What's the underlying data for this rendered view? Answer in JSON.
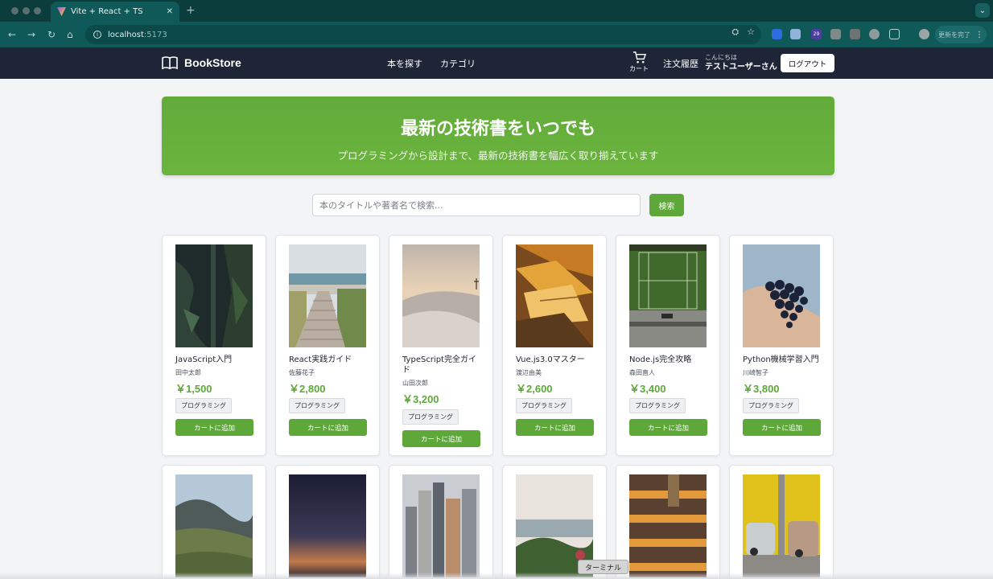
{
  "browser": {
    "tab_title": "Vite + React + TS",
    "new_tab": "+",
    "url_host": "localhost",
    "url_port": ":5173",
    "update_label": "更新を完了",
    "ext_badge": "29"
  },
  "header": {
    "brand": "BookStore",
    "nav": [
      "本を探す",
      "カテゴリ"
    ],
    "cart_label": "カート",
    "orders_label": "注文履歴",
    "greeting": "こんにちは",
    "user_name": "テストユーザーさん",
    "logout_label": "ログアウト"
  },
  "hero": {
    "title": "最新の技術書をいつでも",
    "subtitle": "プログラミングから設計まで、最新の技術書を幅広く取り揃えています"
  },
  "search": {
    "placeholder": "本のタイトルや著者名で検索...",
    "button_label": "検索"
  },
  "books": [
    {
      "title": "JavaScript入門",
      "author": "田中太郎",
      "price": "￥1,500",
      "tag": "プログラミング",
      "add_label": "カートに追加",
      "cover": "moss"
    },
    {
      "title": "React実践ガイド",
      "author": "佐藤花子",
      "price": "￥2,800",
      "tag": "プログラミング",
      "add_label": "カートに追加",
      "cover": "boardwalk"
    },
    {
      "title": "TypeScript完全ガイド",
      "author": "山田次郎",
      "price": "￥3,200",
      "tag": "プログラミング",
      "add_label": "カートに追加",
      "cover": "dune"
    },
    {
      "title": "Vue.js3.0マスター",
      "author": "渡辺由美",
      "price": "￥2,600",
      "tag": "プログラミング",
      "add_label": "カートに追加",
      "cover": "leaves"
    },
    {
      "title": "Node.js完全攻略",
      "author": "森田直人",
      "price": "￥3,400",
      "tag": "プログラミング",
      "add_label": "カートに追加",
      "cover": "tennis"
    },
    {
      "title": "Python機械学習入門",
      "author": "川崎智子",
      "price": "￥3,800",
      "tag": "プログラミング",
      "add_label": "カートに追加",
      "cover": "grapes"
    }
  ],
  "books_row2_covers": [
    "mountain",
    "dusk",
    "city",
    "coast",
    "stairs",
    "cars"
  ],
  "terminal_label": "ターミナル"
}
